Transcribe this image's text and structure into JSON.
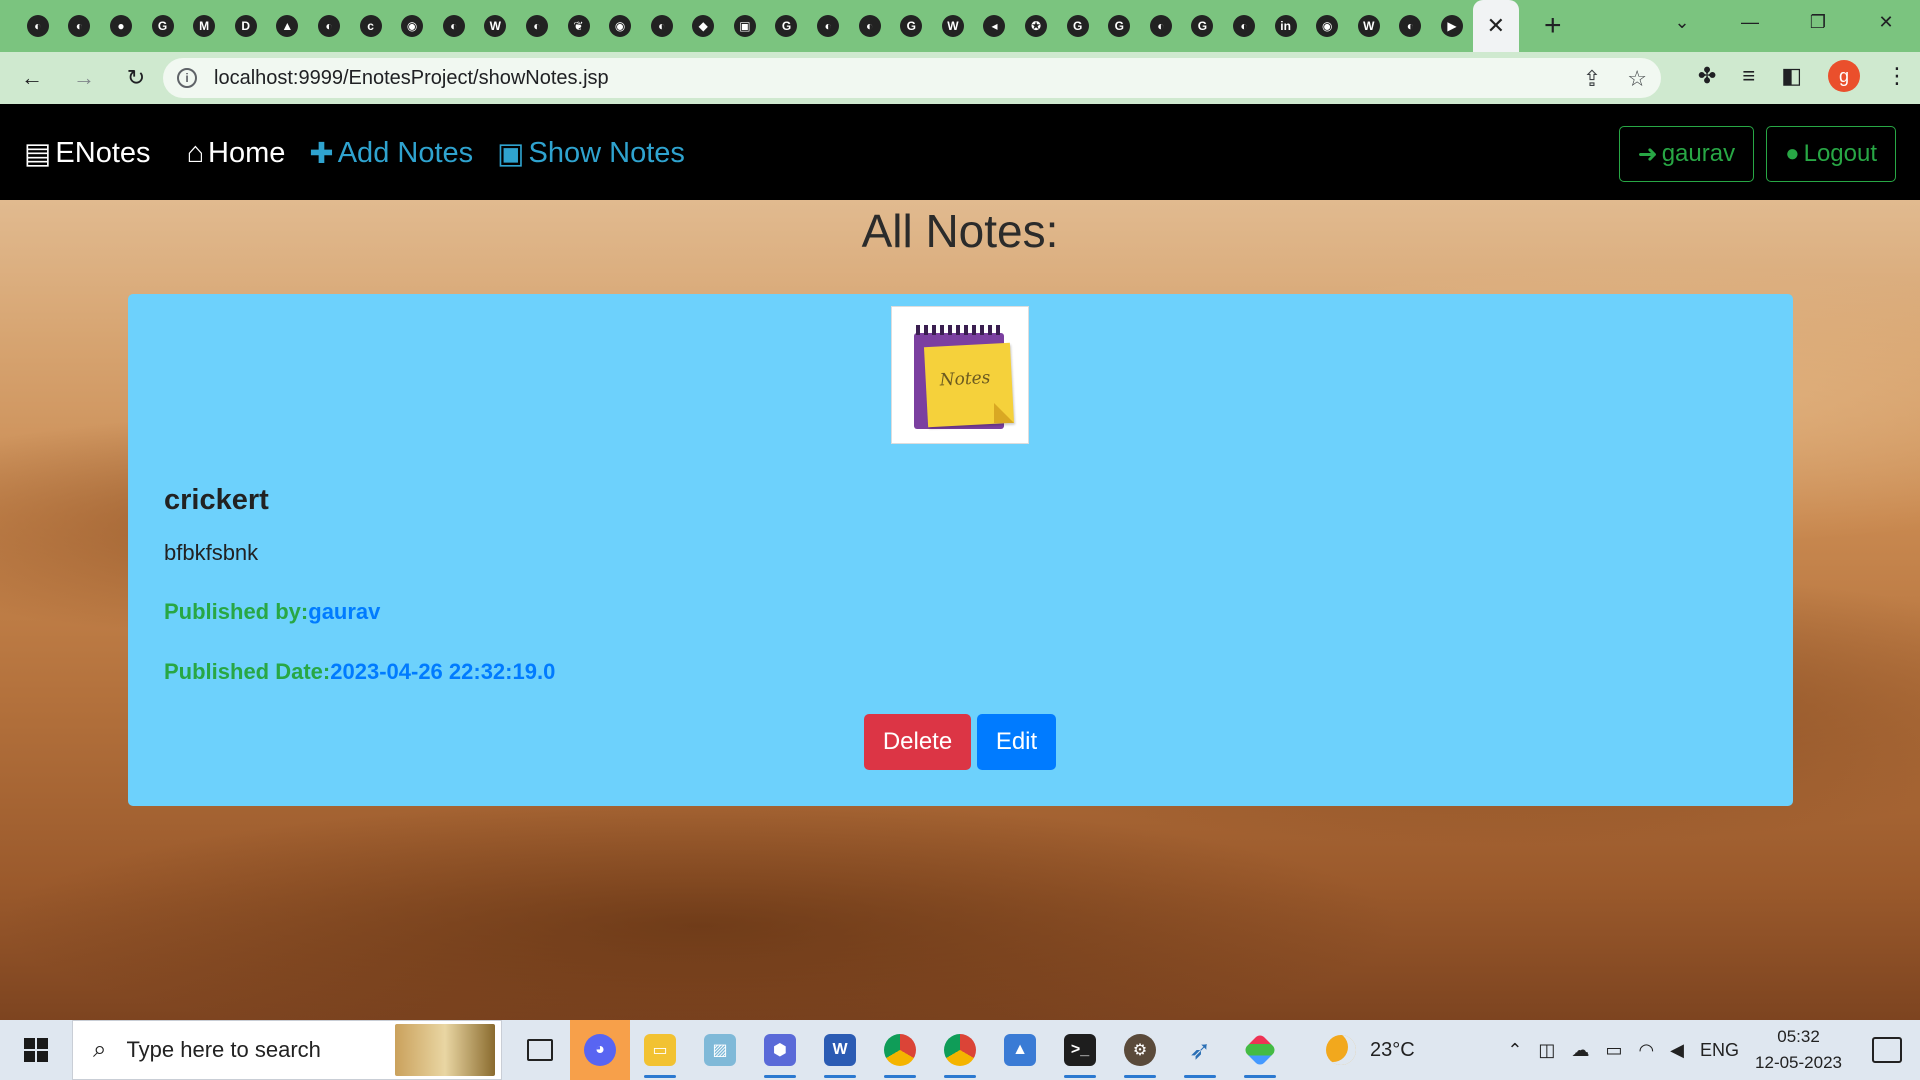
{
  "browser": {
    "tabs": [
      {
        "icon": "globe-icon",
        "glyph": "◐"
      },
      {
        "icon": "globe-icon",
        "glyph": "◐"
      },
      {
        "icon": "bear-icon",
        "glyph": "●"
      },
      {
        "icon": "google-icon",
        "glyph": "G"
      },
      {
        "icon": "gmail-icon",
        "glyph": "M"
      },
      {
        "icon": "dashlane-icon",
        "glyph": "D"
      },
      {
        "icon": "triangle-app-icon",
        "glyph": "▲"
      },
      {
        "icon": "globe-icon",
        "glyph": "◐"
      },
      {
        "icon": "app-icon",
        "glyph": "c"
      },
      {
        "icon": "github-icon",
        "glyph": "◉"
      },
      {
        "icon": "globe-icon",
        "glyph": "◐"
      },
      {
        "icon": "w-app-icon",
        "glyph": "W"
      },
      {
        "icon": "globe-icon",
        "glyph": "◐"
      },
      {
        "icon": "leaf-icon",
        "glyph": "❦"
      },
      {
        "icon": "github-icon",
        "glyph": "◉"
      },
      {
        "icon": "globe-icon",
        "glyph": "◐"
      },
      {
        "icon": "diamond-icon",
        "glyph": "◆"
      },
      {
        "icon": "translate-icon",
        "glyph": "▣"
      },
      {
        "icon": "google-icon",
        "glyph": "G"
      },
      {
        "icon": "globe-icon",
        "glyph": "◐"
      },
      {
        "icon": "globe-icon",
        "glyph": "◐"
      },
      {
        "icon": "google-icon",
        "glyph": "G"
      },
      {
        "icon": "wikipedia-icon",
        "glyph": "W"
      },
      {
        "icon": "audio-icon",
        "glyph": "◂"
      },
      {
        "icon": "star-badge-icon",
        "glyph": "✪"
      },
      {
        "icon": "google-icon",
        "glyph": "G"
      },
      {
        "icon": "google-icon",
        "glyph": "G"
      },
      {
        "icon": "globe-icon",
        "glyph": "◐"
      },
      {
        "icon": "google-icon",
        "glyph": "G"
      },
      {
        "icon": "globe-icon",
        "glyph": "◐"
      },
      {
        "icon": "linkedin-icon",
        "glyph": "in"
      },
      {
        "icon": "github-icon",
        "glyph": "◉"
      },
      {
        "icon": "w-app-icon",
        "glyph": "W"
      },
      {
        "icon": "globe-icon",
        "glyph": "◐"
      },
      {
        "icon": "youtube-icon",
        "glyph": "▶"
      }
    ],
    "active_tab_close": "✕",
    "new_tab": "+",
    "url": "localhost:9999/EnotesProject/showNotes.jsp",
    "profile_initial": "g"
  },
  "nav": {
    "brand": "ENotes",
    "home": "Home",
    "add_notes": "Add Notes",
    "show_notes": "Show Notes",
    "user": "gaurav",
    "logout": "Logout"
  },
  "page": {
    "title": "All Notes:"
  },
  "note": {
    "image_text": "Notes",
    "title": "crickert",
    "content": "bfbkfsbnk",
    "published_by_label": "Published by:",
    "published_by": "gaurav",
    "published_date_label": "Published Date:",
    "published_date": "2023-04-26 22:32:19.0",
    "delete_label": "Delete",
    "edit_label": "Edit"
  },
  "taskbar": {
    "search_placeholder": "Type here to search",
    "weather": "23°C",
    "language": "ENG",
    "time": "05:32",
    "date": "12-05-2023"
  }
}
